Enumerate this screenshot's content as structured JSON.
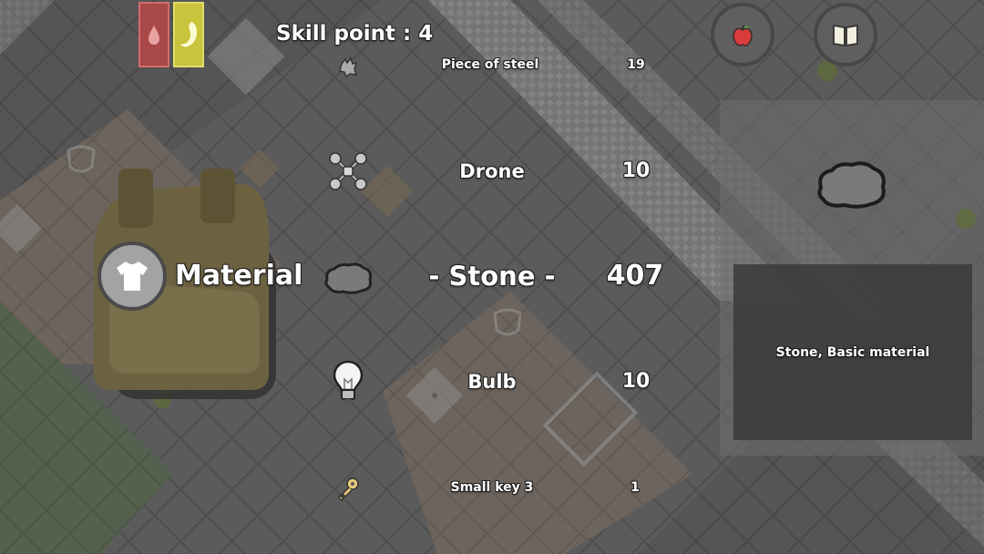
{
  "hud": {
    "skill_points_label": "Skill point : 4"
  },
  "status_bars": [
    {
      "name": "blood",
      "color": "#a84848",
      "icon": "blood-drop-icon"
    },
    {
      "name": "hunger",
      "color": "#c8c43c",
      "icon": "stomach-icon"
    }
  ],
  "buttons": {
    "food": {
      "icon": "apple-icon"
    },
    "journal": {
      "icon": "book-icon"
    }
  },
  "category": {
    "label": "Material",
    "icon": "shirt-icon"
  },
  "inventory": {
    "items": [
      {
        "name": "Piece of steel",
        "count": "19",
        "icon": "steel-piece-icon"
      },
      {
        "name": "Drone",
        "count": "10",
        "icon": "drone-icon"
      },
      {
        "name": "- Stone -",
        "count": "407",
        "icon": "stone-icon",
        "selected": true
      },
      {
        "name": "Bulb",
        "count": "10",
        "icon": "bulb-icon"
      },
      {
        "name": "Small key 3",
        "count": "1",
        "icon": "key-icon"
      }
    ]
  },
  "detail": {
    "icon": "stone-icon",
    "description": "Stone, Basic material"
  },
  "colors": {
    "background": "#585858",
    "floor_tile": "#5c5c5c",
    "rug": "#6f6760",
    "grass": "#55624f",
    "backpack": "#6c6240",
    "info_panel": "#3a3a3a",
    "status_blood": "#a84848",
    "status_hunger": "#c8c43c"
  }
}
